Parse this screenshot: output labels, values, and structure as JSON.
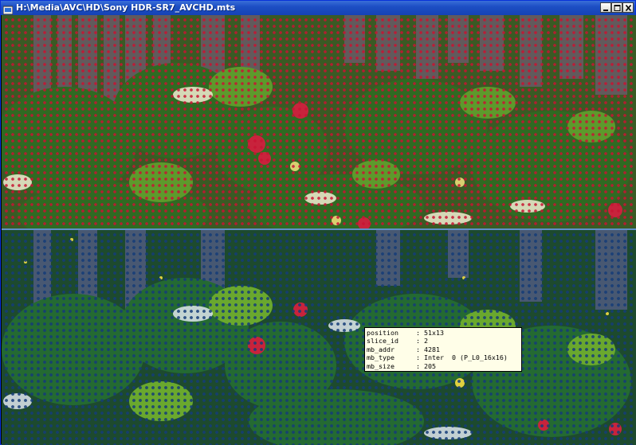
{
  "window": {
    "title": "H:\\Media\\AVC\\HD\\Sony HDR-SR7_AVCHD.mts"
  },
  "controls": {
    "minimize": "minimize-icon",
    "maximize": "maximize-icon",
    "close": "close-icon"
  },
  "views": [
    {
      "name": "decoded-frame-with-macroblock-overlay",
      "overlay_color": "#c81432"
    },
    {
      "name": "macroblock-type-map",
      "overlay_color": "#143c78"
    }
  ],
  "macroblock_info": {
    "rows": [
      {
        "key": "position",
        "sep": ":",
        "value": "51x13"
      },
      {
        "key": "slice_id",
        "sep": ":",
        "value": "2"
      },
      {
        "key": "mb_addr",
        "sep": ":",
        "value": "4281"
      },
      {
        "key": "mb_type",
        "sep": ":",
        "value": "Inter  0 (P_L0_16x16)"
      },
      {
        "key": "mb_size",
        "sep": ":",
        "value": "205"
      }
    ]
  }
}
